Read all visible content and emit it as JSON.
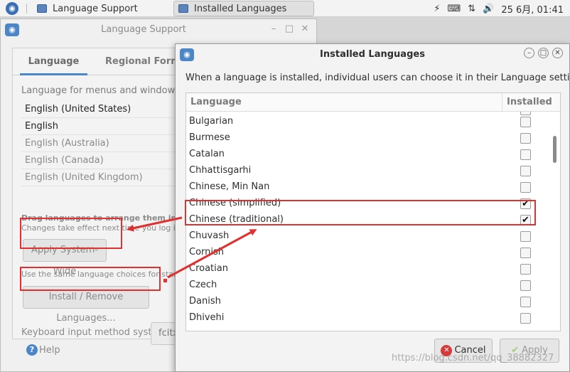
{
  "taskbar": {
    "tasks": [
      {
        "label": "Language Support"
      },
      {
        "label": "Installed Languages"
      }
    ],
    "tray": {
      "lightning_icon": "⚡",
      "keyboard_icon": "⌨",
      "network_icon": "⇅",
      "volume_icon": "🔊",
      "clock": "25 6月, 01:41"
    }
  },
  "language_support": {
    "title": "Language Support",
    "tabs": [
      "Language",
      "Regional Format"
    ],
    "prompt": "Language for menus and windows:",
    "languages": [
      {
        "label": "English (United States)",
        "dim": false
      },
      {
        "label": "English",
        "dim": false
      },
      {
        "label": "English (Australia)",
        "dim": true
      },
      {
        "label": "English (Canada)",
        "dim": true
      },
      {
        "label": "English (United Kingdom)",
        "dim": true
      }
    ],
    "drag_note": "Drag languages to arrange them in order o",
    "effect_note": "Changes take effect next time you log in.",
    "apply_system_wide": "Apply System-Wide",
    "startup_note": "Use the same language choices for startup a",
    "install_remove": "Install / Remove Languages...",
    "keyboard_label": "Keyboard input method system:",
    "keyboard_value": "fcitx",
    "help": "Help"
  },
  "installed_languages": {
    "title": "Installed Languages",
    "description": "When a language is installed, individual users can choose it in their Language settings.",
    "columns": {
      "language": "Language",
      "installed": "Installed"
    },
    "rows": [
      {
        "name": "Bulgarian",
        "installed": false
      },
      {
        "name": "Burmese",
        "installed": false
      },
      {
        "name": "Catalan",
        "installed": false
      },
      {
        "name": "Chhattisgarhi",
        "installed": false
      },
      {
        "name": "Chinese, Min Nan",
        "installed": false
      },
      {
        "name": "Chinese (simplified)",
        "installed": true
      },
      {
        "name": "Chinese (traditional)",
        "installed": true
      },
      {
        "name": "Chuvash",
        "installed": false
      },
      {
        "name": "Cornish",
        "installed": false
      },
      {
        "name": "Croatian",
        "installed": false
      },
      {
        "name": "Czech",
        "installed": false
      },
      {
        "name": "Danish",
        "installed": false
      },
      {
        "name": "Dhivehi",
        "installed": false
      }
    ],
    "cancel": "Cancel",
    "apply": "Apply"
  },
  "watermark": "https://blog.csdn.net/qq_38882327",
  "colors": {
    "annotation": "#e03030",
    "accent": "#4a86c8"
  }
}
